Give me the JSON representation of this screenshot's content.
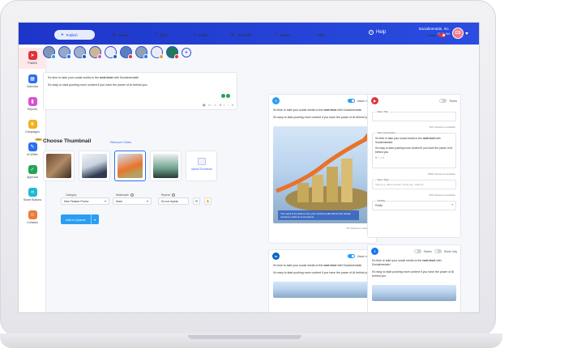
{
  "topbar": {
    "help_label": "Help",
    "account_name": "Socialmentals, Inc.",
    "account_time": "08:00 AM",
    "avatar_initials": "CS"
  },
  "sidebar": {
    "items": [
      {
        "label": "Publish",
        "icon": "paper-plane-icon",
        "color": "#e1323a"
      },
      {
        "label": "Calendar",
        "icon": "calendar-icon",
        "color": "#2a6ff0"
      },
      {
        "label": "Reports",
        "icon": "bar-chart-icon",
        "color": "#d84fd1"
      },
      {
        "label": "Campaigns",
        "icon": "trophy-icon",
        "color": "#f2b01e"
      },
      {
        "label": "AI Writer",
        "icon": "ai-writer-icon",
        "color": "#2a6ff0",
        "badge": "New"
      },
      {
        "label": "Approval",
        "icon": "approval-icon",
        "color": "#23a455"
      },
      {
        "label": "Share Buttons",
        "icon": "share-icon",
        "color": "#1fb9d6"
      },
      {
        "label": "Contacts",
        "icon": "contacts-icon",
        "color": "#f07a3a"
      }
    ]
  },
  "tabs": [
    {
      "label": "Publish",
      "icon": "paper-plane-icon"
    },
    {
      "label": "Queue",
      "icon": "queue-icon"
    },
    {
      "label": "Sent",
      "icon": "grid-icon"
    },
    {
      "label": "Drafts",
      "icon": "draft-icon"
    },
    {
      "label": "Schedule",
      "icon": "schedule-icon"
    },
    {
      "label": "Import",
      "icon": "import-icon"
    },
    {
      "label": "RSS",
      "icon": "rss-icon"
    }
  ],
  "guide_label": "Guide",
  "composer": {
    "line1_pre": "It's time to take your social media to the ",
    "line1_bold": "next level",
    "line1_post": " with Socialmentals!",
    "line2": "It's easy to start pushing more content if you have the power of AI behind you."
  },
  "thumbnail": {
    "heading": "Choose Thumbnail",
    "remove_label": "Remove Video",
    "upload_label": "Upload Thumbnail"
  },
  "fields": {
    "category_label": "Category",
    "category_value": "New Feature Promo",
    "watermark_label": "Watermark",
    "watermark_value": "None",
    "repeat_label": "Repeat",
    "repeat_value": "Do not repeat"
  },
  "add_to_queue_label": "Add to Queue",
  "twitter_card": {
    "attach_label": "Attach media",
    "line1_pre": "It's time to take your social media to the ",
    "line1_bold": "next level",
    "line1_post": " with Socialmentals!",
    "line2": "It's easy to start pushing more content if you have the power of AI behind you.",
    "caption": "You need to be able to turn your social media efforts into actual customer sales & conversions.",
    "chars_label": "78 characters available"
  },
  "linkedin_card": {
    "attach_label": "Attach media",
    "line1_pre": "It's time to take your social media to the ",
    "line1_bold": "next level",
    "line1_post": " with Socialmentals!",
    "line2": "It's easy to start pushing more content if you have the power of AI behind you."
  },
  "youtube_card": {
    "shorts_label": "Shorts",
    "title_legend": "Video Title",
    "title_chars": "100 characters available",
    "desc_legend": "Video Description",
    "desc_line1_pre": "It's time to take your social media to the ",
    "desc_line1_bold": "next level",
    "desc_line1_post": " with Socialmentals!",
    "desc_line2": "It's easy to start pushing more content if you have the power of AI behind you.",
    "desc_chars": "4888 characters available",
    "tags_legend": "Video Tags",
    "tags_placeholder": "Tags (e.g. albert einstein, flying pig, mashup)",
    "tags_chars": "500 characters available",
    "visibility_legend": "Visibility",
    "visibility_value": "Public"
  },
  "facebook_card": {
    "stories_label": "Stories",
    "reels_label": "Reels Only",
    "line1_pre": "It's time to take your social media to the ",
    "line1_bold": "next level",
    "line1_post": " with Socialmentals!",
    "line2": "It's easy to start pushing more content if you have the power of AI behind you."
  },
  "colors": {
    "brand_blue": "#2a4ce0",
    "twitter": "#2a9df4",
    "youtube": "#e1323a",
    "linkedin": "#0a66c2",
    "facebook": "#1877f2"
  }
}
